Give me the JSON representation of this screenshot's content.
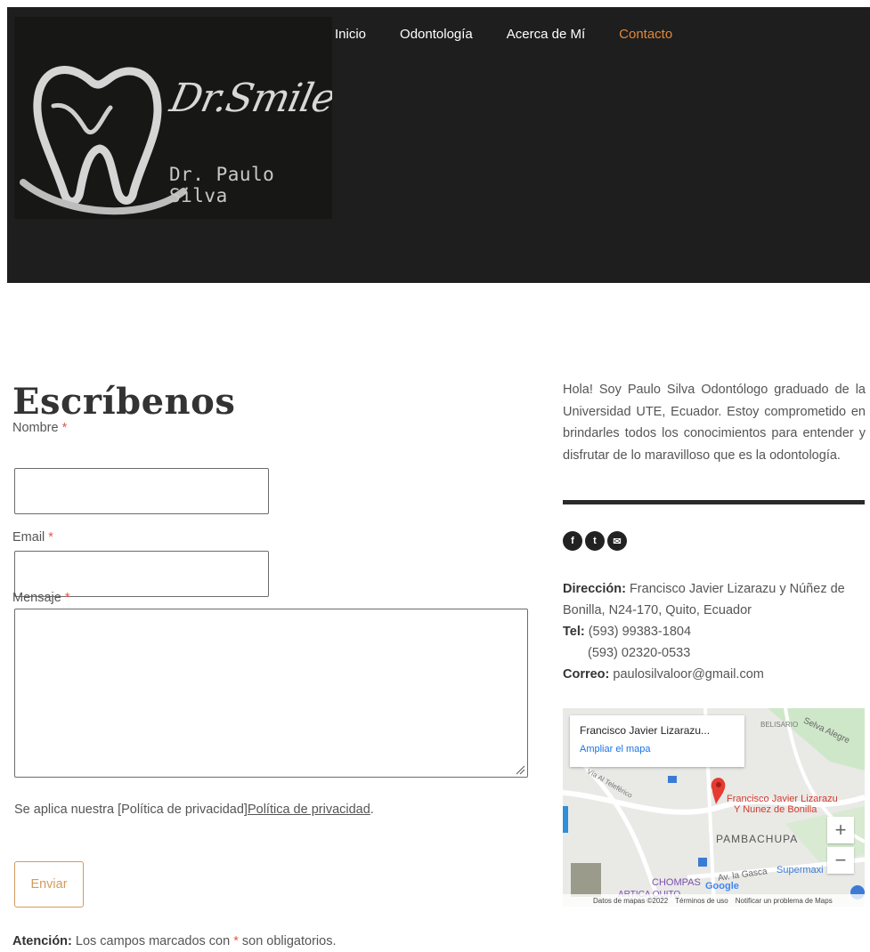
{
  "header": {
    "logo_script": "Dr.Smile",
    "logo_subtitle": "Dr. Paulo Silva",
    "nav": [
      {
        "label": "Inicio"
      },
      {
        "label": "Odontología"
      },
      {
        "label": "Acerca de Mí"
      },
      {
        "label": "Contacto",
        "active": true
      }
    ]
  },
  "form": {
    "title": "Escríbenos",
    "name_label": "Nombre",
    "email_label": "Email",
    "message_label": "Mensaje",
    "required_mark": "*",
    "privacy_prefix": "Se aplica nuestra [Política de privacidad]",
    "privacy_link": "Política de privacidad",
    "privacy_suffix": ".",
    "submit_label": "Enviar",
    "notice_bold": "Atención:",
    "notice_pre": " Los campos marcados con ",
    "notice_mark": "*",
    "notice_post": " son obligatorios."
  },
  "sidebar": {
    "about": "Hola!  Soy Paulo Silva Odontólogo graduado de la Universidad UTE, Ecuador. Estoy comprometido en brindarles todos los conocimientos para entender y disfrutar de lo maravilloso que es la odontología.",
    "social": [
      {
        "icon": "facebook-icon",
        "glyph": "f"
      },
      {
        "icon": "twitter-icon",
        "glyph": "t"
      },
      {
        "icon": "email-icon",
        "glyph": "✉"
      }
    ],
    "address_label": "Dirección:",
    "address_line1": " Francisco Javier Lizarazu y Núñez de",
    "address_line2": "Bonilla, N24-170, Quito, Ecuador",
    "tel_label": "Tel:",
    "tel_1": " (593) 99383-1804",
    "tel_2": "(593) 02320-0533",
    "email_label": "Correo:",
    "email_value": " paulosilvaloor@gmail.com"
  },
  "map": {
    "card_title": "Francisco Javier Lizarazu...",
    "card_link": "Ampliar el mapa",
    "pin_label_1": "Francisco Javier Lizarazu",
    "pin_label_2": "Y Nunez de Bonilla",
    "area_1": "PAMBACHUPA",
    "area_2": "CHOMPAS",
    "area_3": "ARTICA QUITO",
    "street_1": "Selva Alegre",
    "street_2": "Vía Al Teleférico",
    "street_3": "Av. la Gasca",
    "street_4": "BELISARIO",
    "shop": "Supermaxi",
    "google": "Google",
    "zoom_in": "+",
    "zoom_out": "−",
    "foot_data": "Datos de mapas ©2022",
    "foot_terms": "Términos de uso",
    "foot_report": "Notificar un problema de Maps"
  },
  "colors": {
    "header_bg": "#1e1e1e",
    "accent": "#e0883a",
    "button": "#d49a5e",
    "required": "#e05a4f"
  }
}
